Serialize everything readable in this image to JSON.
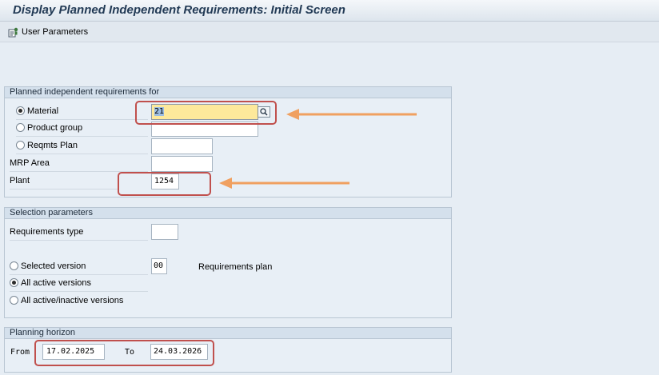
{
  "window": {
    "title": "Display Planned Independent Requirements: Initial Screen"
  },
  "toolbar": {
    "user_parameters": "User Parameters"
  },
  "pir_for": {
    "title": "Planned independent requirements for",
    "material_label": "Material",
    "material_value": "21",
    "product_group_label": "Product group",
    "reqmts_plan_label": "Reqmts Plan",
    "mrp_area_label": "MRP Area",
    "plant_label": "Plant",
    "plant_value": "1254",
    "selected_option": "Material"
  },
  "selection": {
    "title": "Selection parameters",
    "requirements_type_label": "Requirements type",
    "selected_version_label": "Selected version",
    "version_value": "00",
    "version_description": "Requirements plan",
    "all_active_label": "All active versions",
    "all_active_inactive_label": "All active/inactive versions",
    "selected_option": "All active versions"
  },
  "horizon": {
    "title": "Planning horizon",
    "from_label": "From",
    "from_value": "17.02.2025",
    "to_label": "To",
    "to_value": "24.03.2026"
  },
  "colors": {
    "highlight_border": "#c0504d",
    "arrow": "#f0a060",
    "active_field": "#fde99b"
  },
  "icons": [
    "user-parameters-icon",
    "value-help-icon",
    "annotation-arrow-icon"
  ]
}
